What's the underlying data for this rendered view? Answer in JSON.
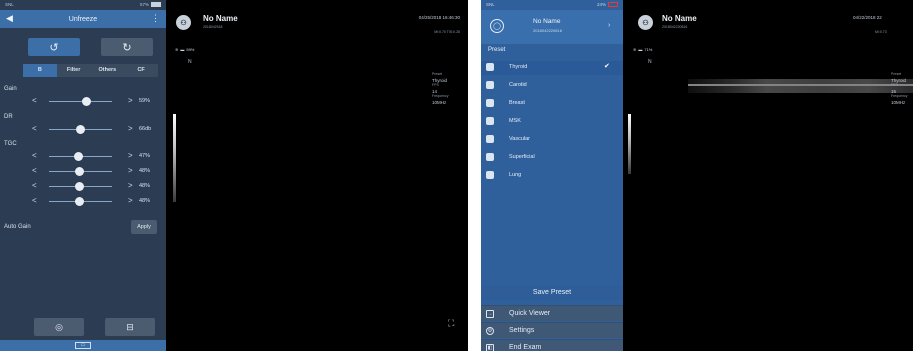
{
  "left": {
    "status": {
      "left": "SNL",
      "battery": "57%"
    },
    "sidebar": {
      "title": "Unfreeze",
      "rotate_left_glyph": "↺",
      "rotate_right_glyph": "↻",
      "tabs": [
        "B",
        "Filter",
        "Others",
        "CF"
      ],
      "active_tab": "B",
      "controls": [
        {
          "label": "Gain",
          "value": "59%",
          "level": 0.59
        },
        {
          "label": "DR",
          "value": "66db",
          "level": 0.5
        }
      ],
      "tgc_label": "TGC",
      "tgc": [
        {
          "value": "47%",
          "level": 0.47
        },
        {
          "value": "48%",
          "level": 0.48
        },
        {
          "value": "48%",
          "level": 0.48
        },
        {
          "value": "48%",
          "level": 0.48
        }
      ],
      "auto_gain_label": "Auto Gain",
      "apply_label": "Apply",
      "camera_glyph": "◎",
      "record_glyph": "⊟",
      "home_glyph": "▭"
    },
    "image": {
      "patient_name": "No Name",
      "patient_id": "2018042518",
      "datetime": "04/25/2018 16:46:30",
      "sub_info": "MI:0.70 TIS:0.28",
      "signal": "59%",
      "probe_marker": "N",
      "params": {
        "preset_label": "Preset",
        "preset": "Thyroid",
        "fps_label": "FPS",
        "fps": "14",
        "freq_label": "Frequency",
        "freq": "10MHz"
      },
      "fullscreen_glyph": "⛶"
    }
  },
  "right": {
    "status": {
      "left": "SNL",
      "battery": "24%"
    },
    "menu": {
      "patient_name": "No Name",
      "patient_id": "2018042220816",
      "preset_title": "Preset",
      "presets": [
        "Thyroid",
        "Carotid",
        "Breast",
        "MSK",
        "Vascular",
        "Superficial",
        "Lung"
      ],
      "selected_preset": "Thyroid",
      "save_preset": "Save Preset",
      "items": [
        {
          "label": "Quick Viewer",
          "icon": "quick-viewer-icon"
        },
        {
          "label": "Settings",
          "icon": "settings-icon"
        },
        {
          "label": "End Exam",
          "icon": "end-exam-icon"
        }
      ]
    },
    "image": {
      "patient_name": "No Name",
      "patient_id": "2018042220816",
      "datetime": "04/22/2018 22",
      "sub_info": "MI:0.73",
      "signal": "71%",
      "probe_marker": "N",
      "params": {
        "preset_label": "Preset",
        "preset": "Thyroid",
        "fps_label": "FPS",
        "fps": "15",
        "freq_label": "Frequency",
        "freq": "10MHz"
      }
    }
  },
  "colors": {
    "accent": "#3c6ea8",
    "sidebar_bg": "#2b3c53",
    "menu_bg": "#2f609c"
  }
}
